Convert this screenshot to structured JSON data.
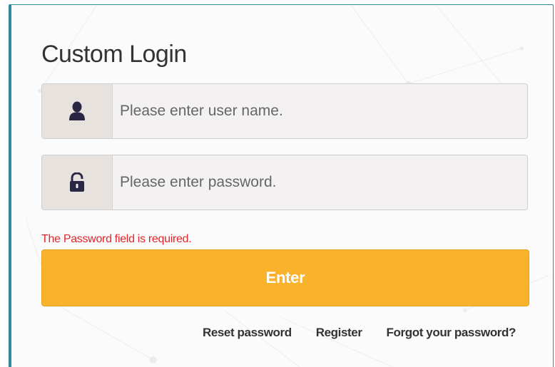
{
  "login": {
    "title": "Custom Login",
    "username": {
      "placeholder": "Please enter user name.",
      "value": "",
      "icon": "user-icon"
    },
    "password": {
      "placeholder": "Please enter password.",
      "value": "",
      "icon": "unlocked-padlock-icon"
    },
    "error_message": "The Password field is required.",
    "enter_label": "Enter",
    "links": {
      "reset": "Reset password",
      "register": "Register",
      "forgot": "Forgot your password?"
    }
  },
  "colors": {
    "accent_border": "#2f8a9c",
    "button": "#f9b22c",
    "error": "#e0262b",
    "icon": "#2a2745",
    "addon_bg": "#e8e2de",
    "input_bg": "#f4f1f2"
  }
}
